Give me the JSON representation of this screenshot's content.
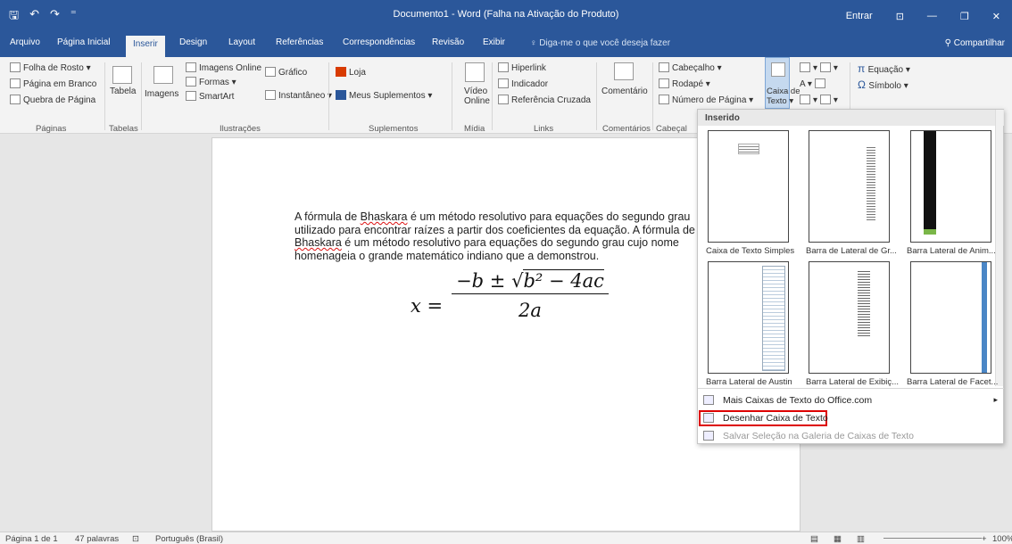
{
  "title": "Documento1  -  Word (Falha na Ativação do Produto)",
  "titlebar": {
    "signin": "Entrar"
  },
  "tabs": [
    "Arquivo",
    "Página Inicial",
    "Inserir",
    "Design",
    "Layout",
    "Referências",
    "Correspondências",
    "Revisão",
    "Exibir"
  ],
  "tellme": "Diga-me o que você deseja fazer",
  "share": "Compartilhar",
  "ribbon": {
    "paginas": {
      "cover": "Folha de Rosto",
      "blank": "Página em Branco",
      "break": "Quebra de Página",
      "group": "Páginas"
    },
    "tabelas": {
      "table": "Tabela",
      "group": "Tabelas"
    },
    "ilustracoes": {
      "images": "Imagens",
      "online": "Imagens Online",
      "shapes": "Formas",
      "smartart": "SmartArt",
      "chart": "Gráfico",
      "screenshot": "Instantâneo",
      "group": "Ilustrações"
    },
    "suplementos": {
      "store": "Loja",
      "myaddins": "Meus Suplementos",
      "group": "Suplementos"
    },
    "midia": {
      "video1": "Vídeo",
      "video2": "Online",
      "group": "Mídia"
    },
    "links": {
      "hyperlink": "Hiperlink",
      "bookmark": "Indicador",
      "crossref": "Referência Cruzada",
      "group": "Links"
    },
    "comentarios": {
      "comment": "Comentário",
      "group": "Comentários"
    },
    "cabecalho": {
      "header": "Cabeçalho",
      "footer": "Rodapé",
      "pagenum": "Número de Página",
      "group": "Cabeçal"
    },
    "texto": {
      "textbox1": "Caixa de",
      "textbox2": "Texto"
    },
    "simbolos": {
      "equation": "Equação",
      "symbol": "Símbolo"
    }
  },
  "document": {
    "p1": "A fórmula de ",
    "w1": "Bhaskara",
    "p2": " é um método resolutivo para equações do segundo grau utilizado para encontrar raízes a partir dos coeficientes da equação. A fórmula de ",
    "w2": "Bhaskara",
    "p3": " é um método resolutivo para equações do segundo grau cujo nome homenageia o grande matemático indiano que a demonstrou.",
    "formula": {
      "lhs": "x =",
      "num1": "−b ± ",
      "num2": "b² − 4ac",
      "den": "2a"
    }
  },
  "dropdown": {
    "header": "Inserido",
    "items": [
      "Caixa de Texto Simples",
      "Barra de Lateral de Gr...",
      "Barra Lateral de Anim...",
      "Barra Lateral de Austin",
      "Barra Lateral de Exibiç...",
      "Barra Lateral de Facet..."
    ],
    "more": "Mais Caixas de Texto do Office.com",
    "draw": "Desenhar Caixa de Texto",
    "save": "Salvar Seleção na Galeria de Caixas de Texto"
  },
  "status": {
    "page": "Página 1 de 1",
    "words": "47 palavras",
    "lang": "Português (Brasil)",
    "zoom": "100%"
  }
}
